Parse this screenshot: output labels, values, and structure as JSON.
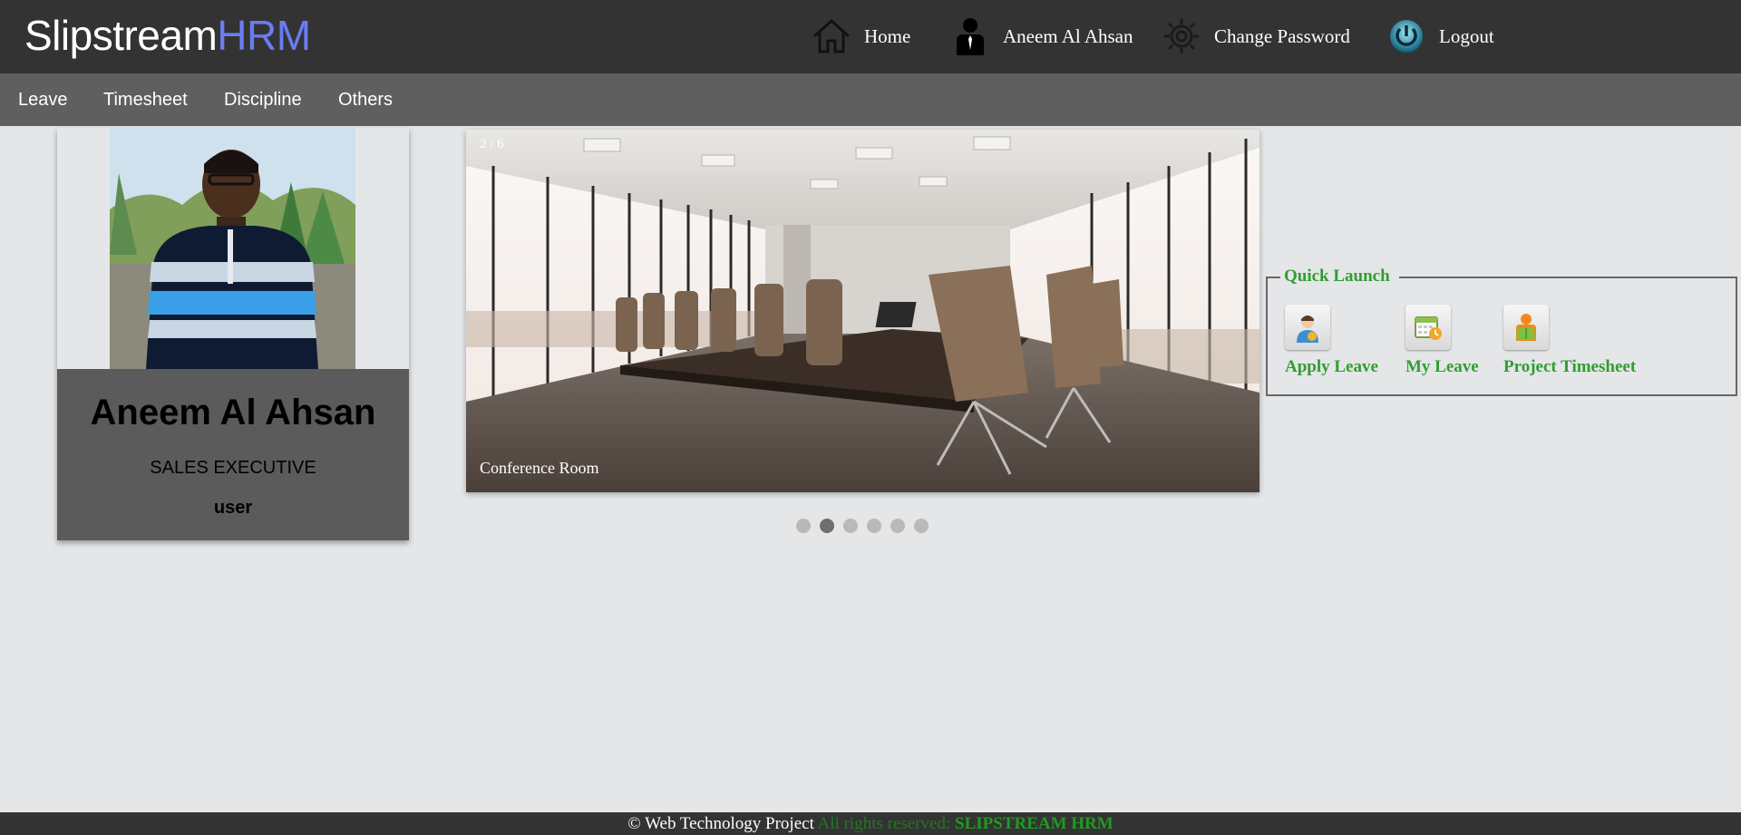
{
  "header": {
    "brand_main": "Slipstream",
    "brand_accent": "HRM",
    "nav": [
      {
        "label": "Home",
        "icon": "home-icon"
      },
      {
        "label": "Aneem Al Ahsan",
        "icon": "user-icon"
      },
      {
        "label": "Change Password",
        "icon": "gear-icon"
      },
      {
        "label": "Logout",
        "icon": "power-icon"
      }
    ]
  },
  "menu": [
    {
      "label": "Leave"
    },
    {
      "label": "Timesheet"
    },
    {
      "label": "Discipline"
    },
    {
      "label": "Others"
    }
  ],
  "profile": {
    "name": "Aneem Al Ahsan",
    "designation": "SALES EXECUTIVE",
    "role": "user"
  },
  "slideshow": {
    "counter": "2 / 6",
    "caption": "Conference Room",
    "total": 6,
    "active_index": 1
  },
  "quick_launch": {
    "legend": "Quick Launch",
    "items": [
      {
        "label": "Apply Leave",
        "icon": "apply-leave-icon"
      },
      {
        "label": "My Leave",
        "icon": "calendar-icon"
      },
      {
        "label": "Project Timesheet",
        "icon": "timesheet-icon"
      }
    ]
  },
  "footer": {
    "copyright": "© Web Technology Project",
    "rights": " All rights reserved: ",
    "brand": "SLIPSTREAM HRM"
  },
  "colors": {
    "header_bg": "#333333",
    "menu_bg": "#5f5f5f",
    "brand_accent": "#6b7cf2",
    "quick_launch_green": "#2f9e2f",
    "page_bg": "#e4e6e8"
  }
}
